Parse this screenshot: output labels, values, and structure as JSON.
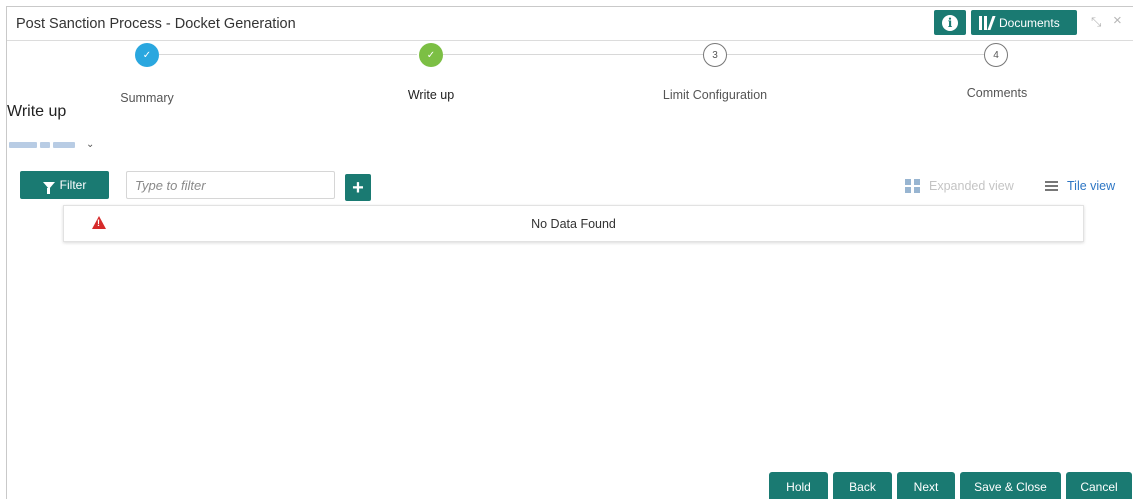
{
  "window": {
    "title": "Post Sanction Process - Docket Generation"
  },
  "header": {
    "info_icon": "info-icon",
    "documents_label": "Documents",
    "minimize_icon": "⤡",
    "close_icon": "×"
  },
  "stepper": {
    "steps": [
      {
        "number": "",
        "label": "Summary",
        "state": "done",
        "color": "#2aa7df"
      },
      {
        "number": "",
        "label": "Write up",
        "state": "current-done",
        "color": "#7cbf44"
      },
      {
        "number": "3",
        "label": "Limit Configuration",
        "state": "pending"
      },
      {
        "number": "4",
        "label": "Comments",
        "state": "pending"
      }
    ]
  },
  "section": {
    "title": "Write up"
  },
  "toolbar": {
    "filter_label": "Filter",
    "filter_placeholder": "Type to filter",
    "add_label": "+",
    "expanded_view_label": "Expanded view",
    "tile_view_label": "Tile view"
  },
  "table": {
    "empty_message": "No Data Found"
  },
  "footer": {
    "hold_label": "Hold",
    "back_label": "Back",
    "next_label": "Next",
    "save_close_label": "Save & Close",
    "cancel_label": "Cancel"
  },
  "colors": {
    "accent": "#1a7a72",
    "link": "#2d76c4",
    "disabled": "#c4c4c4",
    "warning": "#d62a2a"
  }
}
